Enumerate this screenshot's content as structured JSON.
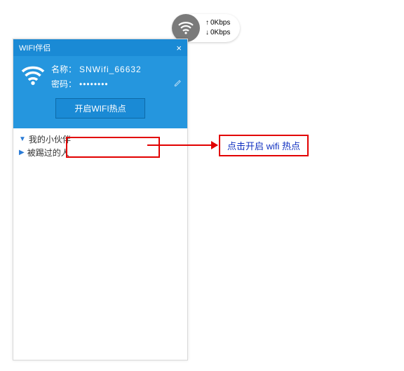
{
  "speed": {
    "upload": "0Kbps",
    "download": "0Kbps"
  },
  "window": {
    "title": "WIFI伴侣",
    "name_label": "名称：",
    "name_value": "SNWifi_66632",
    "pwd_label": "密码：",
    "pwd_value": "••••••••",
    "hotspot_button": "开启WIFI热点"
  },
  "list": {
    "item1": "我的小伙伴",
    "item2": "被踢过的人"
  },
  "callout": "点击开启 wifi 热点"
}
